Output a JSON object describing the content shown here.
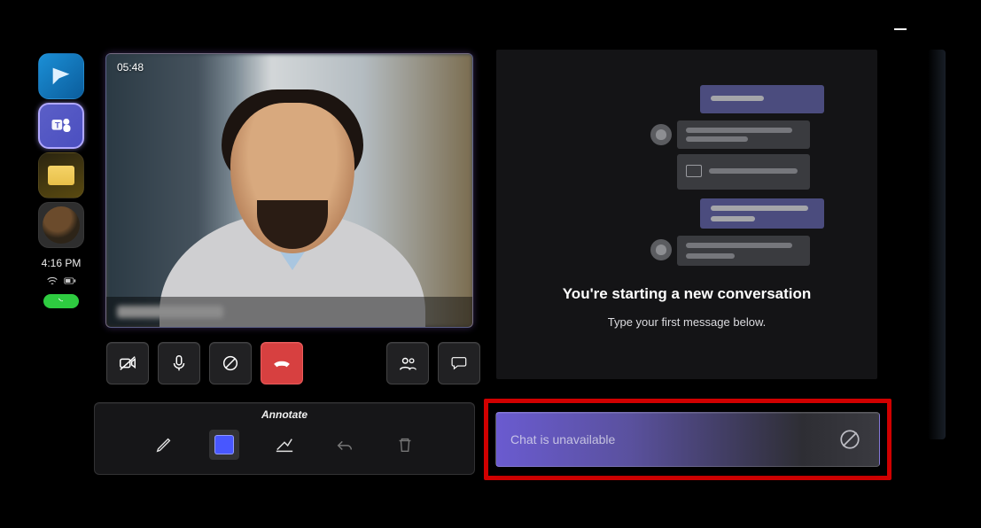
{
  "rail": {
    "clock": "4:16 PM"
  },
  "call": {
    "duration": "05:48"
  },
  "annotate": {
    "title": "Annotate"
  },
  "chat": {
    "heading": "You're starting a new conversation",
    "sub": "Type your first message below.",
    "input_placeholder": "Chat is unavailable"
  }
}
